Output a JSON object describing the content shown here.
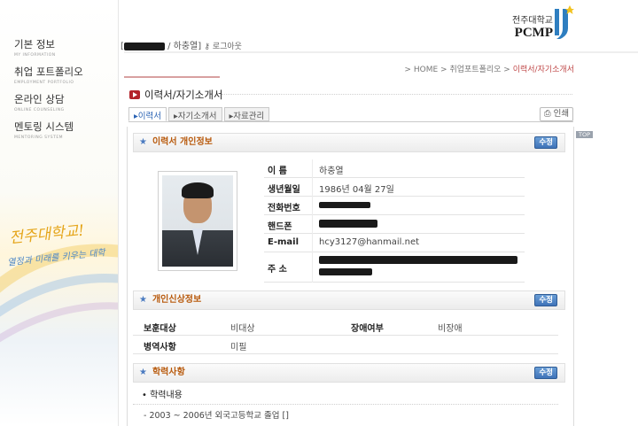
{
  "sidebar": {
    "items": [
      {
        "label": "기본 정보",
        "sub": "MY INFORMATION"
      },
      {
        "label": "취업 포트폴리오",
        "sub": "EMPLOYMENT PORTFOLIO"
      },
      {
        "label": "온라인 상담",
        "sub": "ONLINE COUNSELING"
      },
      {
        "label": "멘토링 시스템",
        "sub": "MENTORING SYSTEM"
      }
    ],
    "slogan_main": "전주대학교!",
    "slogan_sub": "열정과 미래를 키우는 대학"
  },
  "header": {
    "user_name": "하충열",
    "logout_label": "로그아웃",
    "logo_ko": "전주대학교",
    "logo_en": "PCMP"
  },
  "breadcrumb": {
    "home": "HOME",
    "section": "취업포트폴리오",
    "current": "이력서/자기소개서",
    "separator": ">"
  },
  "page": {
    "title": "이력서/자기소개서",
    "tabs": [
      "이력서",
      "자기소개서",
      "자료관리"
    ],
    "print_label": "인쇄",
    "top_label": "TOP"
  },
  "sections": {
    "personal": {
      "title": "이력서 개인정보",
      "edit_label": "수정"
    },
    "background": {
      "title": "개인신상정보",
      "edit_label": "수정"
    },
    "education": {
      "title": "학력사항",
      "edit_label": "수정"
    }
  },
  "personal": {
    "rows": [
      {
        "label": "이 름",
        "value": "하충열"
      },
      {
        "label": "생년월일",
        "value": "1986년 04월 27일"
      },
      {
        "label": "전화번호",
        "value": ""
      },
      {
        "label": "핸드폰",
        "value": ""
      },
      {
        "label": "E-mail",
        "value": "hcy3127@hanmail.net"
      },
      {
        "label": "주 소",
        "value": ""
      }
    ]
  },
  "background": {
    "veteran_label": "보훈대상",
    "veteran_value": "비대상",
    "disability_label": "장애여부",
    "disability_value": "비장애",
    "military_label": "병역사항",
    "military_value": "미필"
  },
  "education": {
    "heading": "• 학력내용",
    "items": [
      "- 2003 ~ 2006년 외국고등학교 졸업 []"
    ]
  },
  "colors": {
    "accent_red": "#b3232a",
    "section_title": "#b85a0d",
    "edit_button": "#3f73b8",
    "tab_active": "#2a63b3"
  }
}
